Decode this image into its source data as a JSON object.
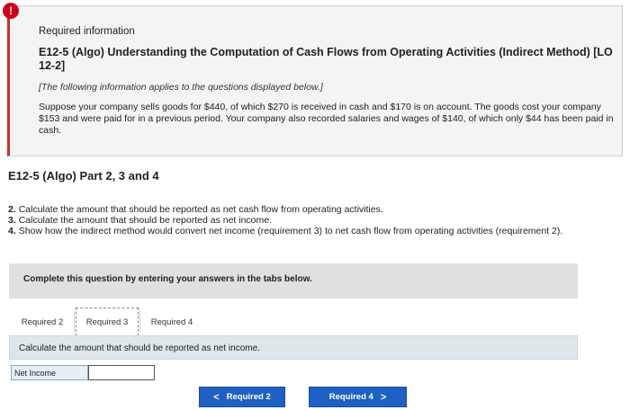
{
  "info": {
    "alert_glyph": "!",
    "heading": "Required information",
    "exercise_title": "E12-5 (Algo) Understanding the Computation of Cash Flows from Operating Activities (Indirect Method) [LO 12-2]",
    "note": "[The following information applies to the questions displayed below.]",
    "scenario": "Suppose your company sells goods for $440, of which $270 is received in cash and $170 is on account. The goods cost your company $153 and were paid for in a previous period. Your company also recorded salaries and wages of $140, of which only $44 has been paid in cash."
  },
  "part_title": "E12-5 (Algo) Part 2, 3 and 4",
  "questions": [
    {
      "number": "2.",
      "text": "Calculate the amount that should be reported as net cash flow from operating activities."
    },
    {
      "number": "3.",
      "text": "Calculate the amount that should be reported as net income."
    },
    {
      "number": "4.",
      "text": "Show how the indirect method would convert net income (requirement 3) to net cash flow from operating activities (requirement 2)."
    }
  ],
  "complete_text": "Complete this question by entering your answers in the tabs below.",
  "tabs": [
    {
      "label": "Required 2",
      "active": false
    },
    {
      "label": "Required 3",
      "active": true
    },
    {
      "label": "Required 4",
      "active": false
    }
  ],
  "instruction": "Calculate the amount that should be reported as net income.",
  "answer": {
    "label": "Net Income",
    "value": ""
  },
  "nav": {
    "prev_label": "Required 2",
    "next_label": "Required 4",
    "prev_glyph": "<",
    "next_glyph": ">"
  },
  "colors": {
    "alert": "#d0021b",
    "nav_button": "#1f60c4",
    "instruction_bar": "#dfe6ea"
  }
}
